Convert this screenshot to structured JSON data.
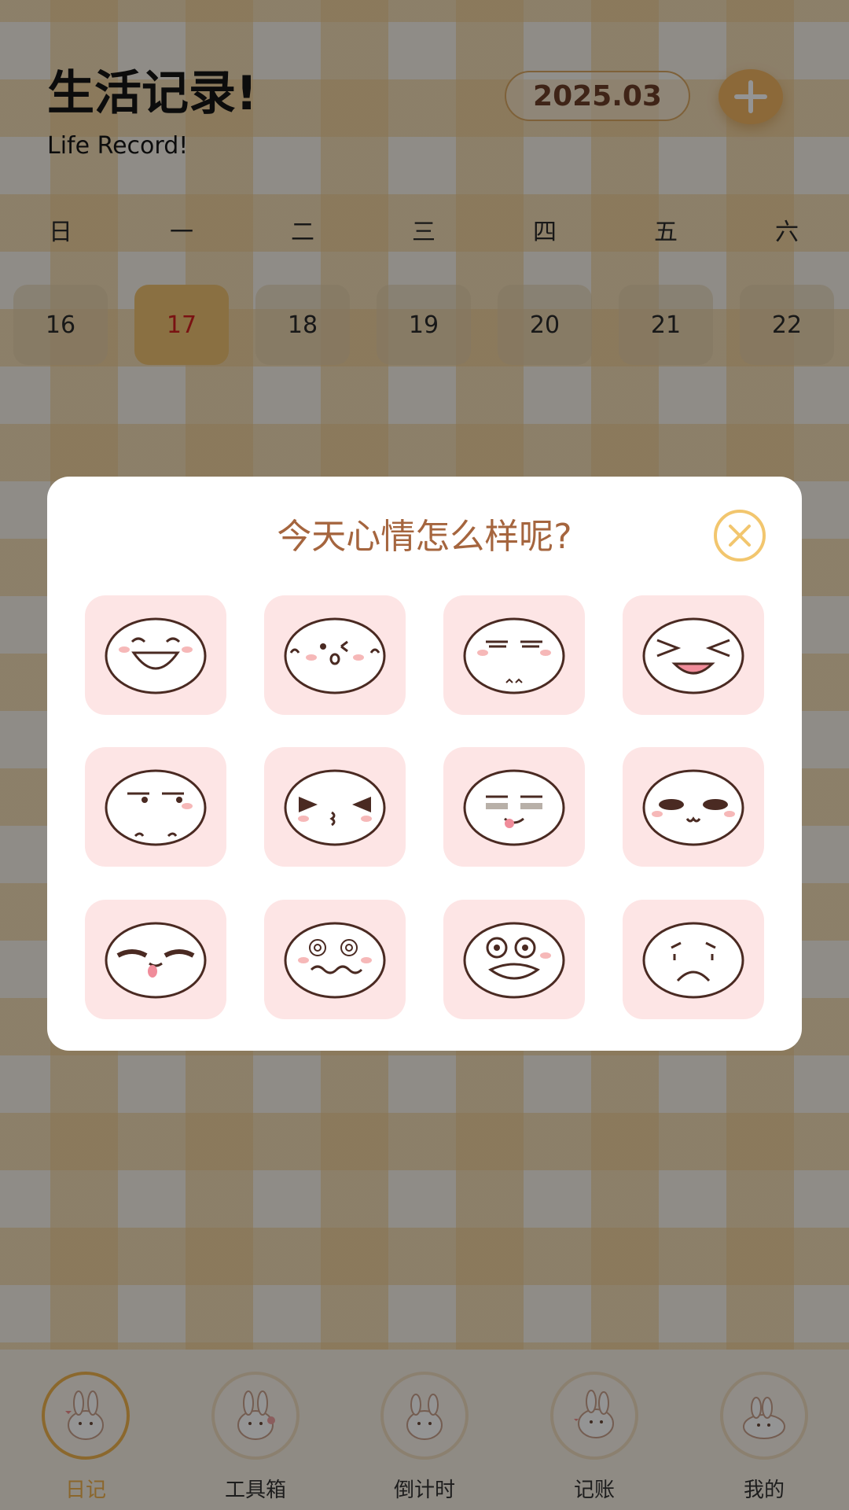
{
  "header": {
    "title": "生活记录!",
    "subtitle": "Life Record!",
    "month": "2025.03",
    "add_icon": "plus-icon"
  },
  "week": {
    "weekdays": [
      "日",
      "一",
      "二",
      "三",
      "四",
      "五",
      "六"
    ],
    "days": [
      "16",
      "17",
      "18",
      "19",
      "20",
      "21",
      "22"
    ],
    "selected_day": "17"
  },
  "modal": {
    "title": "今天心情怎么样呢?",
    "close_icon": "close-circle-icon",
    "moods": [
      "laughing-face-icon",
      "wink-face-icon",
      "smirk-face-icon",
      "squint-laugh-face-icon",
      "side-eye-face-icon",
      "kiss-squint-face-icon",
      "tongue-out-face-icon",
      "blush-face-icon",
      "sleepy-tongue-face-icon",
      "dizzy-face-icon",
      "shocked-face-icon",
      "sad-face-icon"
    ]
  },
  "tabbar": {
    "tabs": [
      {
        "label": "日记",
        "icon": "bunny-diary-icon",
        "active": true
      },
      {
        "label": "工具箱",
        "icon": "bunny-toolbox-icon",
        "active": false
      },
      {
        "label": "倒计时",
        "icon": "bunny-countdown-icon",
        "active": false
      },
      {
        "label": "记账",
        "icon": "bunny-bookkeeping-icon",
        "active": false
      },
      {
        "label": "我的",
        "icon": "bunny-profile-icon",
        "active": false
      }
    ]
  },
  "colors": {
    "accent": "#f2b662",
    "modal_title": "#a5653e",
    "selected_day_text": "#d21f1f",
    "mood_tile": "#fde5e5"
  }
}
